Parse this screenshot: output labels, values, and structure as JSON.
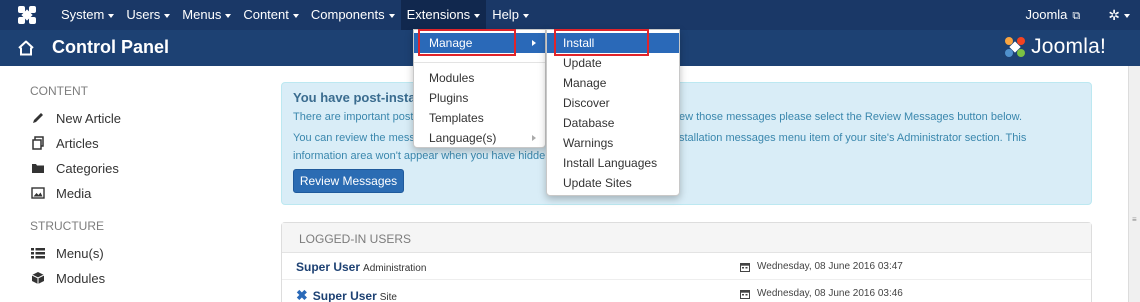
{
  "topbar": {
    "menu": [
      {
        "label": "System"
      },
      {
        "label": "Users"
      },
      {
        "label": "Menus"
      },
      {
        "label": "Content"
      },
      {
        "label": "Components"
      },
      {
        "label": "Extensions"
      },
      {
        "label": "Help"
      }
    ],
    "site_link": "Joomla"
  },
  "header": {
    "title": "Control Panel",
    "brand": "Joomla!"
  },
  "sidebar": {
    "content_title": "CONTENT",
    "content_items": [
      {
        "label": "New Article",
        "icon": "pencil-icon"
      },
      {
        "label": "Articles",
        "icon": "copy-icon"
      },
      {
        "label": "Categories",
        "icon": "folder-icon"
      },
      {
        "label": "Media",
        "icon": "image-icon"
      }
    ],
    "structure_title": "STRUCTURE",
    "structure_items": [
      {
        "label": "Menu(s)",
        "icon": "list-icon"
      },
      {
        "label": "Modules",
        "icon": "cube-icon"
      }
    ]
  },
  "alert": {
    "heading": "You have post-install",
    "line1_start": "There are important post-",
    "line1_end": "ew those messages please select the Review Messages button below.",
    "line2_start": "You can review the mess",
    "line2_end": "stallation messages menu item of your site's Administrator section. This",
    "line3": "information area won't appear when you have hidden",
    "button": "Review Messages"
  },
  "logged_in": {
    "title": "LOGGED-IN USERS",
    "rows": [
      {
        "user": "Super User",
        "location": "Administration",
        "date": "Wednesday, 08 June 2016 03:47"
      },
      {
        "user": "Super User",
        "location": "Site",
        "date": "Wednesday, 08 June 2016 03:46"
      }
    ]
  },
  "extensions_menu": {
    "items": [
      {
        "label": "Manage"
      },
      {
        "label": "Modules"
      },
      {
        "label": "Plugins"
      },
      {
        "label": "Templates"
      },
      {
        "label": "Language(s)"
      }
    ]
  },
  "manage_submenu": {
    "items": [
      {
        "label": "Install"
      },
      {
        "label": "Update"
      },
      {
        "label": "Manage"
      },
      {
        "label": "Discover"
      },
      {
        "label": "Database"
      },
      {
        "label": "Warnings"
      },
      {
        "label": "Install Languages"
      },
      {
        "label": "Update Sites"
      }
    ]
  },
  "colors": {
    "topbar": "#1a3867",
    "header": "#1d4173",
    "accent": "#2a69b8",
    "alert_bg": "#d9edf7",
    "highlight_box": "#e0242a"
  }
}
